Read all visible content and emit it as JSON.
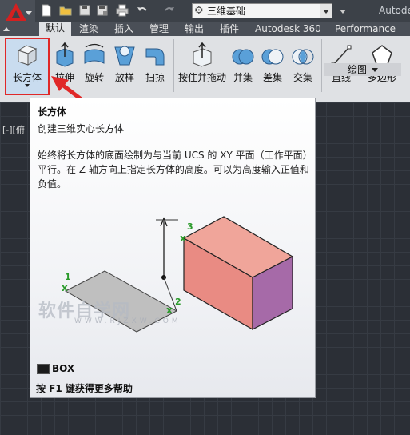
{
  "window": {
    "title": "Autodesk",
    "workspace": "三维基础"
  },
  "tabs": [
    "默认",
    "渲染",
    "插入",
    "管理",
    "输出",
    "插件",
    "Autodesk 360",
    "Performance"
  ],
  "ribbon": {
    "buttons": [
      {
        "label": "长方体",
        "icon": "box-icon"
      },
      {
        "label": "拉伸",
        "icon": "extrude-icon"
      },
      {
        "label": "旋转",
        "icon": "revolve-icon"
      },
      {
        "label": "放样",
        "icon": "loft-icon"
      },
      {
        "label": "扫掠",
        "icon": "sweep-icon"
      },
      {
        "label": "按住并拖动",
        "icon": "presspull-icon"
      },
      {
        "label": "并集",
        "icon": "union-icon"
      },
      {
        "label": "差集",
        "icon": "subtract-icon"
      },
      {
        "label": "交集",
        "icon": "intersect-icon"
      },
      {
        "label": "直线",
        "icon": "line-icon"
      },
      {
        "label": "多边形",
        "icon": "polygon-icon"
      }
    ],
    "panel_label": "绘图"
  },
  "viewport": {
    "label": "[-][俯"
  },
  "tooltip": {
    "title": "长方体",
    "subtitle": "创建三维实心长方体",
    "description": "始终将长方体的底面绘制为与当前 UCS 的 XY 平面（工作平面）平行。在 Z 轴方向上指定长方体的高度。可以为高度输入正值和负值。",
    "points": [
      "1",
      "2",
      "3"
    ],
    "command": "BOX",
    "help": "按 F1 键获得更多帮助"
  },
  "watermark": {
    "text": "软件自学网",
    "url": "WWW.RJZXW.COM"
  },
  "colors": {
    "highlight": "#e02828",
    "box_front": "#e98b83",
    "box_side": "#a66aa8",
    "point_marker": "#2a9a2a"
  }
}
